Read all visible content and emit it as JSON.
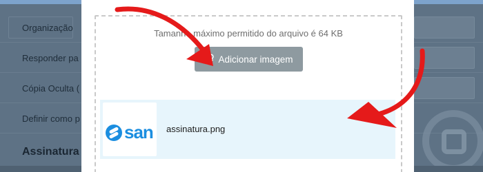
{
  "background": {
    "rows": [
      {
        "label": "Organização"
      },
      {
        "label": "Responder pa"
      },
      {
        "label": "Cópia Oculta ("
      },
      {
        "label": "Definir como p"
      }
    ],
    "section_heading": "Assinatura",
    "watermark": "logo-watermark-icon"
  },
  "modal": {
    "max_size_text": "Tamanho máximo permitido do arquivo é 64 KB",
    "add_button_label": "Adicionar imagem",
    "add_button_icon": "paperclip-icon",
    "file": {
      "name": "assinatura.png",
      "thumbnail_text": "san"
    }
  },
  "annotations": {
    "arrow_color": "#e51a1a",
    "count": 2
  },
  "colors": {
    "accent": "#1b8ee0",
    "button": "#8e9aa0",
    "file_item_bg": "#e7f5fc"
  }
}
